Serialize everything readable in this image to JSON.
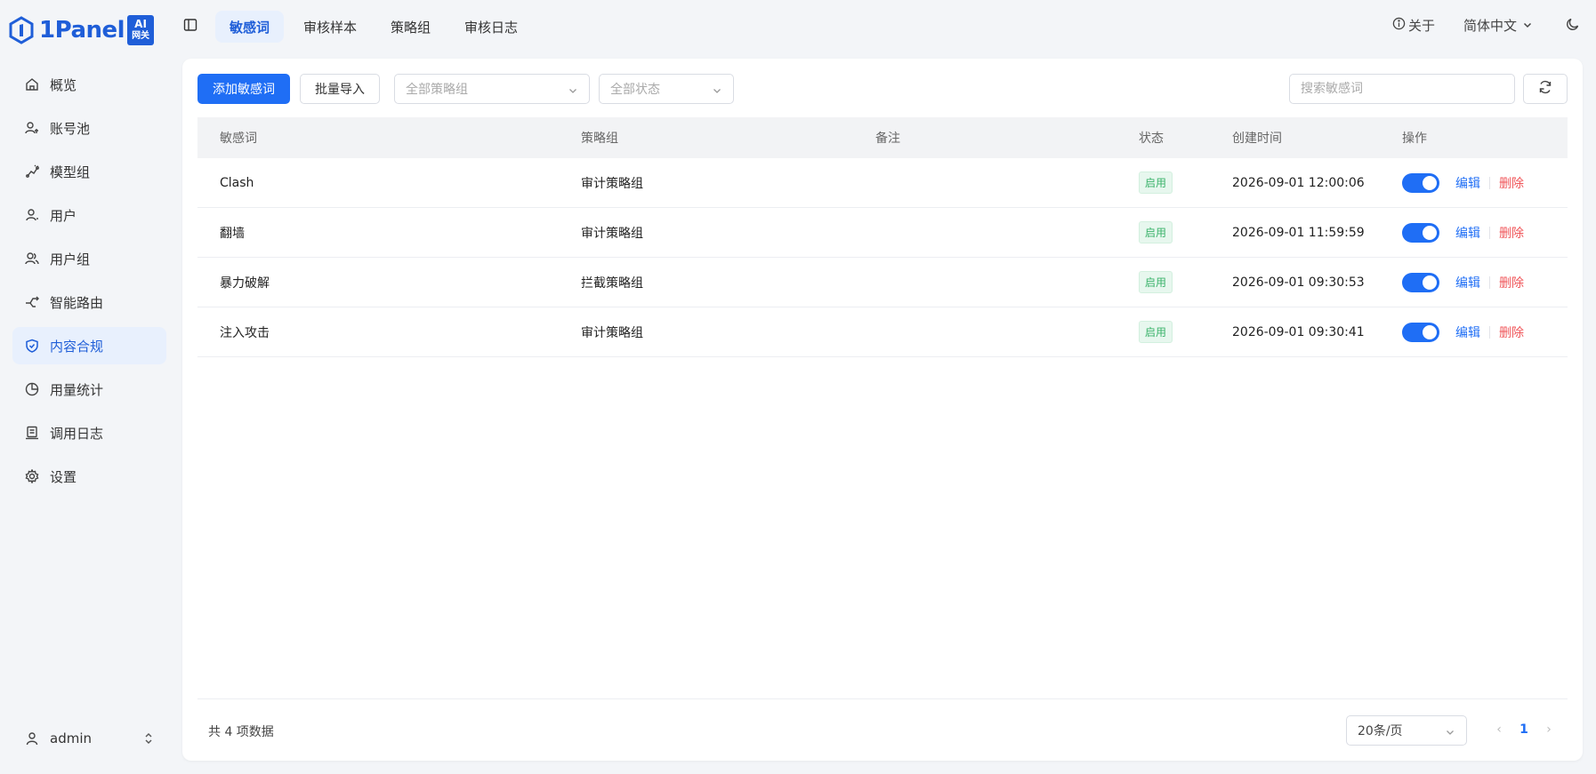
{
  "brand": {
    "name": "1Panel",
    "badge_top": "AI",
    "badge_bottom": "网关"
  },
  "sidebar": {
    "items": [
      {
        "label": "概览",
        "icon": "home-icon"
      },
      {
        "label": "账号池",
        "icon": "account-pool-icon"
      },
      {
        "label": "模型组",
        "icon": "model-group-icon"
      },
      {
        "label": "用户",
        "icon": "user-icon"
      },
      {
        "label": "用户组",
        "icon": "user-group-icon"
      },
      {
        "label": "智能路由",
        "icon": "route-icon"
      },
      {
        "label": "内容合规",
        "icon": "shield-icon",
        "active": true
      },
      {
        "label": "用量统计",
        "icon": "pie-chart-icon"
      },
      {
        "label": "调用日志",
        "icon": "log-icon"
      },
      {
        "label": "设置",
        "icon": "gear-icon"
      }
    ],
    "user": "admin"
  },
  "header": {
    "tabs": [
      {
        "label": "敏感词",
        "active": true
      },
      {
        "label": "审核样本"
      },
      {
        "label": "策略组"
      },
      {
        "label": "审核日志"
      }
    ],
    "about": "关于",
    "language": "简体中文"
  },
  "toolbar": {
    "add_label": "添加敏感词",
    "import_label": "批量导入",
    "policy_select": "全部策略组",
    "status_select": "全部状态",
    "search_placeholder": "搜索敏感词"
  },
  "table": {
    "columns": [
      "敏感词",
      "策略组",
      "备注",
      "状态",
      "创建时间",
      "操作"
    ],
    "rows": [
      {
        "word": "Clash",
        "group": "审计策略组",
        "note": "",
        "status": "启用",
        "created": "2026-09-01 12:00:06"
      },
      {
        "word": "翻墙",
        "group": "审计策略组",
        "note": "",
        "status": "启用",
        "created": "2026-09-01 11:59:59"
      },
      {
        "word": "暴力破解",
        "group": "拦截策略组",
        "note": "",
        "status": "启用",
        "created": "2026-09-01 09:30:53"
      },
      {
        "word": "注入攻击",
        "group": "审计策略组",
        "note": "",
        "status": "启用",
        "created": "2026-09-01 09:30:41"
      }
    ],
    "edit_label": "编辑",
    "delete_label": "删除"
  },
  "footer": {
    "total": "共 4 项数据",
    "page_size": "20条/页",
    "current_page": "1"
  },
  "colors": {
    "accent": "#1f6ef5",
    "danger": "#f0565a",
    "success": "#3bb36b"
  }
}
